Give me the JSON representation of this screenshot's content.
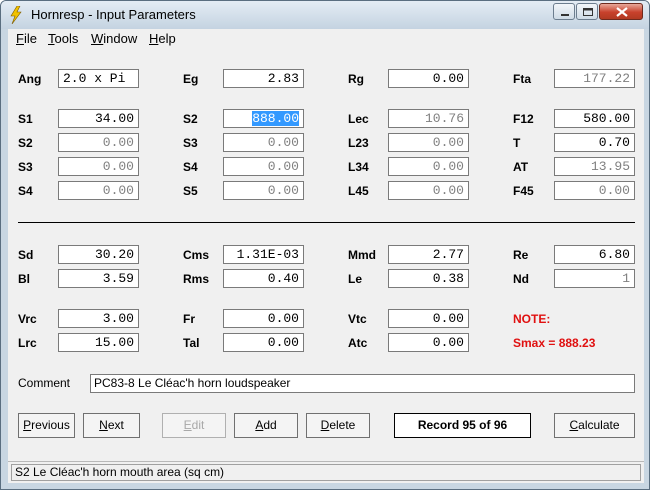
{
  "window": {
    "title": "Hornresp - Input Parameters"
  },
  "menu": [
    {
      "label": "File",
      "mn": "F",
      "rest": "ile"
    },
    {
      "label": "Tools",
      "mn": "T",
      "rest": "ools"
    },
    {
      "label": "Window",
      "mn": "W",
      "rest": "indow"
    },
    {
      "label": "Help",
      "mn": "H",
      "rest": "elp"
    }
  ],
  "fields": {
    "ang": {
      "label": "Ang",
      "value": "2.0 x Pi"
    },
    "eg": {
      "label": "Eg",
      "value": "2.83"
    },
    "rg": {
      "label": "Rg",
      "value": "0.00"
    },
    "fta": {
      "label": "Fta",
      "value": "177.22"
    },
    "s1": {
      "label": "S1",
      "value": "34.00"
    },
    "s2_top": {
      "label": "S2",
      "value": "888.00"
    },
    "lec": {
      "label": "Lec",
      "value": "10.76"
    },
    "f12": {
      "label": "F12",
      "value": "580.00"
    },
    "s2": {
      "label": "S2",
      "value": "0.00"
    },
    "s3_top": {
      "label": "S3",
      "value": "0.00"
    },
    "l23": {
      "label": "L23",
      "value": "0.00"
    },
    "t": {
      "label": "T",
      "value": "0.70"
    },
    "s3": {
      "label": "S3",
      "value": "0.00"
    },
    "s4_top": {
      "label": "S4",
      "value": "0.00"
    },
    "l34": {
      "label": "L34",
      "value": "0.00"
    },
    "at": {
      "label": "AT",
      "value": "13.95"
    },
    "s4": {
      "label": "S4",
      "value": "0.00"
    },
    "s5": {
      "label": "S5",
      "value": "0.00"
    },
    "l45": {
      "label": "L45",
      "value": "0.00"
    },
    "f45": {
      "label": "F45",
      "value": "0.00"
    },
    "sd": {
      "label": "Sd",
      "value": "30.20"
    },
    "cms": {
      "label": "Cms",
      "value": "1.31E-03"
    },
    "mmd": {
      "label": "Mmd",
      "value": "2.77"
    },
    "re": {
      "label": "Re",
      "value": "6.80"
    },
    "bl": {
      "label": "Bl",
      "value": "3.59"
    },
    "rms": {
      "label": "Rms",
      "value": "0.40"
    },
    "le": {
      "label": "Le",
      "value": "0.38"
    },
    "nd": {
      "label": "Nd",
      "value": "1"
    },
    "vrc": {
      "label": "Vrc",
      "value": "3.00"
    },
    "fr": {
      "label": "Fr",
      "value": "0.00"
    },
    "vtc": {
      "label": "Vtc",
      "value": "0.00"
    },
    "lrc": {
      "label": "Lrc",
      "value": "15.00"
    },
    "tal": {
      "label": "Tal",
      "value": "0.00"
    },
    "atc": {
      "label": "Atc",
      "value": "0.00"
    }
  },
  "note": {
    "label": "NOTE:",
    "smax": "Smax = 888.23"
  },
  "comment": {
    "label": "Comment",
    "value": "PC83-8 Le Cléac'h horn loudspeaker"
  },
  "buttons": {
    "previous": {
      "mn": "P",
      "rest": "revious"
    },
    "next": {
      "mn": "N",
      "rest": "ext"
    },
    "edit": {
      "mn": "E",
      "rest": "dit"
    },
    "add": {
      "mn": "A",
      "rest": "dd"
    },
    "delete": {
      "mn": "D",
      "rest": "elete"
    },
    "calculate": {
      "mn": "C",
      "rest": "alculate"
    }
  },
  "record": "Record 95 of 96",
  "status": "S2   Le Cléac'h horn mouth area  (sq cm)",
  "colors": {
    "note": "#e01010",
    "selection": "#3399ff"
  }
}
